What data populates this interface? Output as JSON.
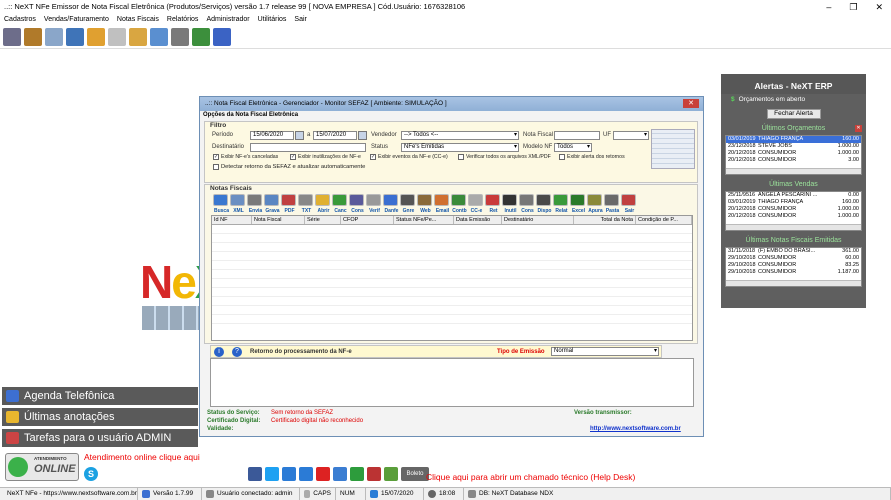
{
  "window": {
    "title": "..:: NeXT NFe Emissor de Nota Fiscal Eletrônica (Produtos/Serviços) versão 1.7 release 99  [ NOVA EMPRESA ]  Cód.Usuário: 1676328106",
    "controls": [
      "–",
      "❐",
      "✕"
    ]
  },
  "menu": [
    "Cadastros",
    "Vendas/Faturamento",
    "Notas Fiscais",
    "Relatórios",
    "Administrador",
    "Utilitários",
    "Sair"
  ],
  "toolbar": {
    "icons": [
      "users-icon",
      "delivery-icon",
      "calculator-icon",
      "disk-icon",
      "edit-icon",
      "document-icon",
      "box-icon",
      "nfe-icon",
      "stamp-icon",
      "chart-icon",
      "help-icon"
    ],
    "colors": [
      "#6d6d8a",
      "#b07a2a",
      "#8aa6c9",
      "#3f74b8",
      "#e0a030",
      "#c0c0c0",
      "#d9a641",
      "#5a8fd0",
      "#7a7a7a",
      "#3c8f3c",
      "#3b63c4"
    ]
  },
  "logo": {
    "text": "NeX"
  },
  "alerts": {
    "title": "Alertas - NeXT ERP",
    "subtitle": "Orçamentos em aberto",
    "close_button": "Fechar Alerta",
    "orcamentos": {
      "title": "Últimos Orçamentos",
      "rows": [
        {
          "date": "03/01/2019",
          "name": "THIAGO FRANÇA",
          "value": "160.00",
          "selected": true
        },
        {
          "date": "23/12/2018",
          "name": "STEVE JOBS",
          "value": "1.000.00"
        },
        {
          "date": "20/12/2018",
          "name": "CONSUMIDOR",
          "value": "1.000.00"
        },
        {
          "date": "20/12/2018",
          "name": "CONSUMIDOR",
          "value": "3.00"
        }
      ]
    },
    "vendas": {
      "title": "Últimas Vendas",
      "rows": [
        {
          "date": "25/11/9516",
          "name": "ANGELA PESCARINI ...",
          "value": "0.00"
        },
        {
          "date": "03/01/2019",
          "name": "THIAGO FRANÇA",
          "value": "160.00"
        },
        {
          "date": "20/12/2018",
          "name": "CONSUMIDOR",
          "value": "1.000.00"
        },
        {
          "date": "20/12/2018",
          "name": "CONSUMIDOR",
          "value": "1.000.00"
        }
      ]
    },
    "notas": {
      "title": "Últimas Notas Fiscais Emitidas",
      "rows": [
        {
          "date": "31/11/2018",
          "name": "(F) EMBO DO BRASI...",
          "value": "361.00"
        },
        {
          "date": "29/10/2018",
          "name": "CONSUMIDOR",
          "value": "60.00"
        },
        {
          "date": "29/10/2018",
          "name": "CONSUMIDOR",
          "value": "83.25"
        },
        {
          "date": "29/10/2018",
          "name": "CONSUMIDOR",
          "value": "1.187.00"
        }
      ]
    }
  },
  "left_panels": {
    "agenda": "Agenda Telefônica",
    "anotacoes": "Últimas anotações",
    "tarefas": "Tarefas para o usuário ADMIN"
  },
  "online": {
    "small": "ATENDIMENTO",
    "big": "ONLINE",
    "link": "Atendimento online clique aqui"
  },
  "helpdesk": {
    "link": "Clique aqui para abrir um chamado técnico (Help Desk)",
    "boleto": "Boleto"
  },
  "statusbar": {
    "site": "NeXT NFe - https://www.nextsoftware.com.br/",
    "version": "Versão  1.7.99",
    "user": "Usuário conectado: admin",
    "caps": "CAPS",
    "num": "NUM",
    "date": "15/07/2020",
    "time": "18:08",
    "db": "DB: NeXT Database NDX"
  },
  "dialog": {
    "title": "..:: Nota Fiscal Eletrônica - Gerenciador - Monitor SEFAZ      [ Ambiente: SIMULAÇÃO ]",
    "subtitle": "Opções da Nota Fiscal Eletrônica",
    "filtro": {
      "group": "Filtro",
      "periodo_label": "Período",
      "date_from": "15/06/2020",
      "a": "a",
      "date_to": "15/07/2020",
      "vendedor_label": "Vendedor",
      "vendedor_value": "--> Todos <--",
      "nota_fiscal_label": "Nota Fiscal",
      "uf_label": "UF",
      "destinatario_label": "Destinatário",
      "status_label": "Status",
      "status_value": "NFe's Emitidas",
      "modelo_label": "Modelo NF",
      "modelo_value": "Todos",
      "chk_canceladas": "Exibir NF-e's canceladas",
      "chk_inutilizacoes": "Exibir inutilizações de NF-e",
      "chk_eventos": "Exibir eventos da NF-e (CC-e)",
      "chk_xml": "Verificar todos os arquivos XML/PDF",
      "chk_alerta": "Exibir alerta dos retornos",
      "chk_detectar": "Detectar retorno da SEFAZ e atualizar automaticamente"
    },
    "notas": {
      "group": "Notas Fiscais",
      "action_labels": [
        "Busca",
        "XML",
        "Envia",
        "Grava",
        "PDF",
        "TXT",
        "Abrir",
        "Canc",
        "Cons",
        "Verif",
        "Danfe",
        "Gnre",
        "Web",
        "Email",
        "Contb",
        "CC-e",
        "Ret",
        "Inutil",
        "Cons",
        "Dispo",
        "Relat",
        "Excel",
        "Apura",
        "Pasta",
        "Sair"
      ],
      "columns": [
        "Id NF",
        "Nota Fiscal",
        "Série",
        "CFOP",
        "Status NFe/Pe...",
        "Data Emissão",
        "Destinatário",
        "Total da Nota",
        "Condição de P..."
      ]
    },
    "retorno": {
      "label": "Retorno do processamento da NF-e",
      "tipo_label": "Tipo de Emissão",
      "tipo_value": "Normal"
    },
    "status": {
      "servico_label": "Status do Serviço:",
      "servico_value": "Sem retorno da SEFAZ",
      "cert_label": "Certificado Digital:",
      "cert_value": "Certificado digital não reconhecido",
      "validade_label": "Validade:",
      "transmissor_label": "Versão transmissor:",
      "site": "http://www.nextsoftware.com.br"
    }
  }
}
